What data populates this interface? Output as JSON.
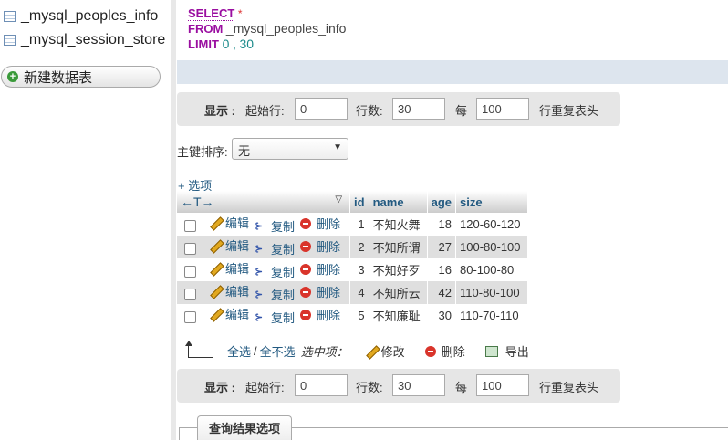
{
  "sidebar": {
    "tables": [
      "_mysql_peoples_info",
      "_mysql_session_store"
    ],
    "new_table_label": "新建数据表"
  },
  "sql": {
    "select": "SELECT",
    "star": "*",
    "from": "FROM",
    "table": "_mysql_peoples_info",
    "limit": "LIMIT",
    "offset": "0",
    "comma": ",",
    "count": "30"
  },
  "nav": {
    "show_label": "显示 :",
    "start_label": "起始行:",
    "start_value": "0",
    "rows_label": "行数:",
    "rows_value": "30",
    "per_label": "每",
    "per_value": "100",
    "repeat_label": "行重复表头"
  },
  "sort": {
    "label": "主键排序:",
    "value": "无"
  },
  "options_link": "+ 选项",
  "grid": {
    "columns": [
      "id",
      "name",
      "age",
      "size"
    ],
    "action_labels": {
      "edit": "编辑",
      "copy": "复制",
      "delete": "删除"
    },
    "rows": [
      {
        "id": "1",
        "name": "不知火舞",
        "age": "18",
        "size": "120-60-120"
      },
      {
        "id": "2",
        "name": "不知所谓",
        "age": "27",
        "size": "100-80-100"
      },
      {
        "id": "3",
        "name": "不知好歹",
        "age": "16",
        "size": "80-100-80"
      },
      {
        "id": "4",
        "name": "不知所云",
        "age": "42",
        "size": "110-80-100"
      },
      {
        "id": "5",
        "name": "不知廉耻",
        "age": "30",
        "size": "110-70-110"
      }
    ]
  },
  "multi": {
    "check_all": "全选",
    "separator": "/",
    "uncheck_all": "全不选",
    "selected_label": "选中项：",
    "modify": "修改",
    "delete": "删除",
    "export": "导出"
  },
  "result_options_tab": "查询结果选项"
}
